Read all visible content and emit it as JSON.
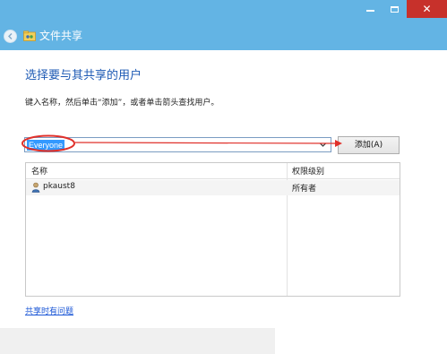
{
  "window": {
    "controls": {
      "minimize": "–",
      "maximize": "□",
      "close": "✕"
    },
    "close_color": "#c7312b",
    "titlebar_color": "#63b4e4"
  },
  "header": {
    "wizard_title": "文件共享",
    "back_icon": "back-arrow-icon",
    "folder_icon": "shared-folder-icon"
  },
  "main": {
    "heading": "选择要与其共享的用户",
    "instruction": "键入名称，然后单击“添加”，或者单击箭头查找用户。",
    "name_input_value": "Everyone",
    "add_button_label": "添加(A)"
  },
  "user_list": {
    "columns": [
      "名称",
      "权限级别"
    ],
    "rows": [
      {
        "name": "pkaust8",
        "permission": "所有者",
        "icon": "user-icon"
      }
    ]
  },
  "footer": {
    "help_link": "共享时有问题"
  },
  "annotation": {
    "color": "#e0312b"
  }
}
